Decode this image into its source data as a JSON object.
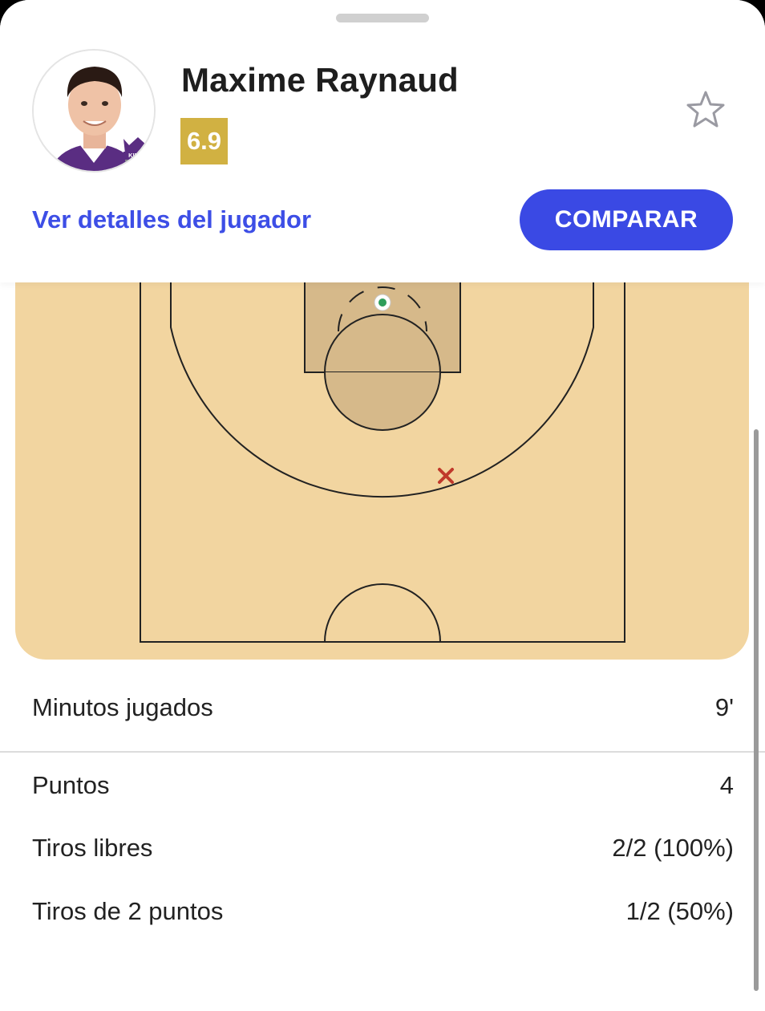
{
  "player": {
    "name": "Maxime Raynaud",
    "rating": "6.9",
    "team_logo_text": "KINGS"
  },
  "actions": {
    "details_link": "Ver detalles del jugador",
    "compare_button": "COMPARAR"
  },
  "colors": {
    "accent": "#3a49e4",
    "rating_badge": "#d1b142",
    "court": "#f2d5a0",
    "paint": "#d6b98a",
    "made_shot": "#2e9e5b",
    "missed_shot": "#c0392b"
  },
  "shot_chart": {
    "shots": [
      {
        "result": "made",
        "icon": "made-shot-dot-icon"
      },
      {
        "result": "missed",
        "icon": "missed-shot-x-icon"
      }
    ]
  },
  "stats": [
    {
      "label": "Minutos jugados",
      "value": "9'"
    },
    {
      "label": "Puntos",
      "value": "4"
    },
    {
      "label": "Tiros libres",
      "value": "2/2 (100%)"
    },
    {
      "label": "Tiros de 2 puntos",
      "value": "1/2 (50%)"
    }
  ]
}
